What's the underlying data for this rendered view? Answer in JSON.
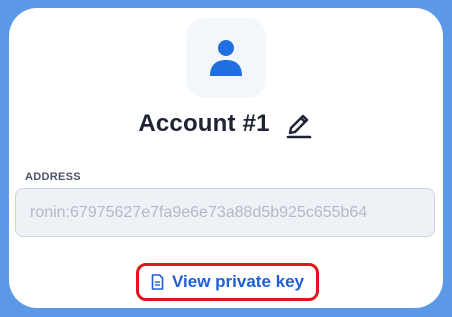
{
  "account": {
    "name": "Account #1"
  },
  "address": {
    "label": "ADDRESS",
    "value": "ronin:67975627e7fa9e6e73a88d5b925c655b64"
  },
  "private_key_link": {
    "label": "View private key"
  },
  "icons": {
    "avatar": "user-icon",
    "edit": "pencil-edit-icon",
    "key_link": "document-icon"
  },
  "colors": {
    "frame": "#5b98e6",
    "accent": "#1f5fd6",
    "highlight": "#e0151f"
  }
}
